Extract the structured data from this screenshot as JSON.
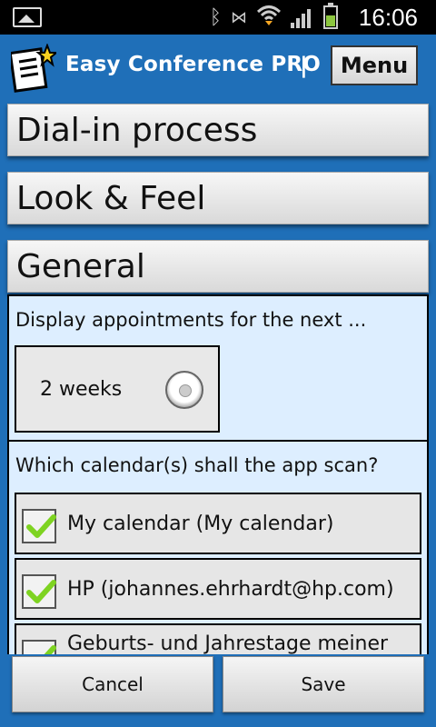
{
  "status_bar": {
    "time": "16:06",
    "icons": [
      "image-icon",
      "bluetooth-icon",
      "vibrate-icon",
      "wifi-icon",
      "signal-icon",
      "battery-icon"
    ]
  },
  "app": {
    "title": "Easy Conference PRO",
    "divider": "|",
    "menu_label": "Menu"
  },
  "sections": [
    {
      "label": "Dial-in process"
    },
    {
      "label": "Look & Feel"
    },
    {
      "label": "General"
    }
  ],
  "general": {
    "appointments_label": "Display appointments for the next ...",
    "appointments_value": "2 weeks",
    "calendars_label": "Which calendar(s) shall the app scan?",
    "calendars": [
      {
        "label": "My calendar (My calendar)",
        "checked": true
      },
      {
        "label": "HP (johannes.ehrhardt@hp.com)",
        "checked": true
      },
      {
        "label": "Geburts- und Jahrestage meiner",
        "checked": true
      }
    ]
  },
  "buttons": {
    "cancel": "Cancel",
    "save": "Save"
  },
  "colors": {
    "background": "#1f6fb8",
    "panel": "#ddeeff",
    "check": "#7ed321"
  }
}
